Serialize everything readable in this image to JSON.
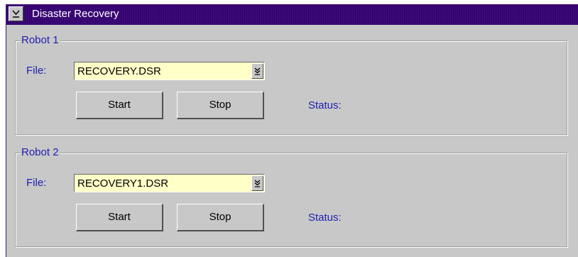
{
  "window": {
    "title": "Disaster Recovery",
    "system_menu_icon": "chevron-down-icon"
  },
  "robots": [
    {
      "group_label": "Robot 1",
      "file_label": "File:",
      "file_value": "RECOVERY.DSR",
      "start_label": "Start",
      "stop_label": "Stop",
      "status_label": "Status:"
    },
    {
      "group_label": "Robot 2",
      "file_label": "File:",
      "file_value": "RECOVERY1.DSR",
      "start_label": "Start",
      "stop_label": "Stop",
      "status_label": "Status:"
    }
  ],
  "colors": {
    "titlebar": "#3b007a",
    "label_text": "#2020b0",
    "combo_background": "#ffffc8",
    "window_background": "#c8c8c8"
  }
}
